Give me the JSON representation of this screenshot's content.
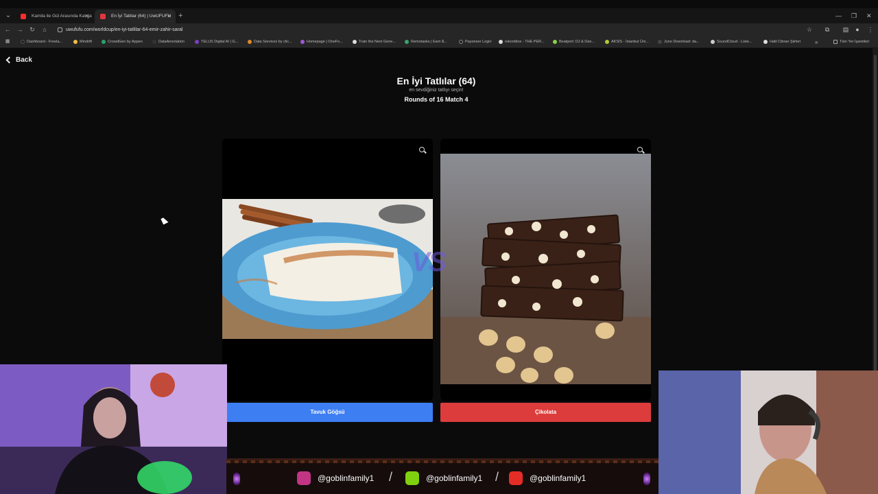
{
  "browser": {
    "tabs": [
      {
        "title": "Kamila ile Gül Arasında Kavga",
        "active": false,
        "favicon_color": "#ff2d2d"
      },
      {
        "title": "En İyi Tatlılar (64) | UwUFUFU",
        "active": true,
        "favicon_color": "#e3353f"
      }
    ],
    "url": "uwufufu.com/worldcup/en-iyi-tatlilar-64-emir-zahir-saral",
    "bookmarks": [
      "Dashboard - Freela...",
      "Mindrift",
      "CrowdGen by Appen",
      "DataAnnotation",
      "TELUS Digital AI | G...",
      "Data Services by clic...",
      "Homepage | OneFo...",
      "Train the Next Gene...",
      "Remotasks | Earn $...",
      "Payoneer Login",
      "rekordbox - THE PER...",
      "Beatport: DJ & Dan...",
      "AKSIS - İstanbul Üni...",
      "Juno Download: da...",
      "SoundCloud - Liste...",
      "Halil Cibran Şiirleri"
    ],
    "all_bookmarks": "Tüm Yer İşaretleri",
    "more_bookmarks": "»"
  },
  "page": {
    "back_label": "Back",
    "title": "En İyi Tatlılar (64)",
    "subtitle": "en sevdiğiniz tatlıyı seçin!",
    "round": "Rounds of 16 Match 4",
    "vs_label": "VS",
    "left_choice": {
      "label": "Tavuk Göğsü",
      "color": "#3d7ef2"
    },
    "right_choice": {
      "label": "Çikolata",
      "color": "#dc3c3c"
    }
  },
  "stream_footer": {
    "handles": [
      {
        "platform_icon": "instagram-icon",
        "handle": "@goblinfamily1",
        "color": "#c13584"
      },
      {
        "platform_icon": "tiktok-icon",
        "handle": "@goblinfamily1",
        "color": "#7fd10f"
      },
      {
        "platform_icon": "youtube-icon",
        "handle": "@goblinfamily1",
        "color": "#e52d27"
      }
    ],
    "separator": "/"
  }
}
